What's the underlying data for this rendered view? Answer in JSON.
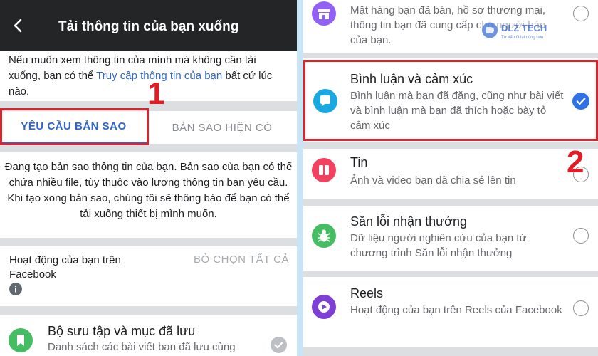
{
  "left": {
    "header": {
      "title": "Tải thông tin của bạn xuống",
      "back_icon": "chevron-left-icon"
    },
    "intro": {
      "before_link": "Nếu muốn xem thông tin của mình mà không cần tải xuống, bạn có thể ",
      "link": "Truy cập thông tin của bạn",
      "after_link": " bất cứ lúc nào."
    },
    "tabs": [
      {
        "label": "YÊU CẦU BẢN SAO",
        "active": true
      },
      {
        "label": "BẢN SAO HIỆN CÓ",
        "active": false
      }
    ],
    "description": "Đang tạo bản sao thông tin của bạn. Bản sao của bạn có thể chứa nhiều file, tùy thuộc vào lượng thông tin bạn yêu cầu. Khi tạo xong bản sao, chúng tôi sẽ thông báo để bạn có thể tải xuống thiết bị mình muốn.",
    "section": {
      "label": "Hoạt động của bạn trên Facebook",
      "deselect_all": "BỎ CHỌN TẤT CẢ"
    },
    "item": {
      "title": "Bộ sưu tập và mục đã lưu",
      "subtitle": "Danh sách các bài viết bạn đã lưu cùng",
      "icon": "bookmark-icon",
      "icon_color": "#45bd62",
      "checked": true
    }
  },
  "right": {
    "items": [
      {
        "title": "",
        "subtitle": "Mặt hàng bạn đã bán, hồ sơ thương mại, thông tin bạn đã cung cấp cho người bán của bạn.",
        "icon": "storefront-icon",
        "icon_color": "#9360f7",
        "checked": false
      },
      {
        "title": "Bình luận và cảm xúc",
        "subtitle": "Bình luận mà bạn đã đăng, cũng như bài viết và bình luận mà bạn đã thích hoặc bày tỏ cảm xúc",
        "icon": "comment-bubble-icon",
        "icon_color": "#1aa8e0",
        "checked": true
      },
      {
        "title": "Tin",
        "subtitle": "Ảnh và video bạn đã chia sẻ lên tin",
        "icon": "book-open-icon",
        "icon_color": "#f3425f",
        "checked": false
      },
      {
        "title": "Săn lỗi nhận thưởng",
        "subtitle": "Dữ liệu người nghiên cứu của bạn từ chương trình Săn lỗi nhận thưởng",
        "icon": "bug-icon",
        "icon_color": "#45bd62",
        "checked": false
      },
      {
        "title": "Reels",
        "subtitle": "Hoạt động của bạn trên Reels của Facebook",
        "icon": "play-circle-icon",
        "icon_color": "#7d3fd4",
        "checked": false
      }
    ]
  },
  "watermark": {
    "brand": "DLZ TECH",
    "tagline": "Tư vấn đi lại cùng bạn"
  },
  "annotations": {
    "step1": "1",
    "step2": "2"
  },
  "colors": {
    "accent": "#2e66c9",
    "check_blue": "#2f72e6",
    "annotation_red": "#d8262e",
    "topbar": "#242526"
  }
}
